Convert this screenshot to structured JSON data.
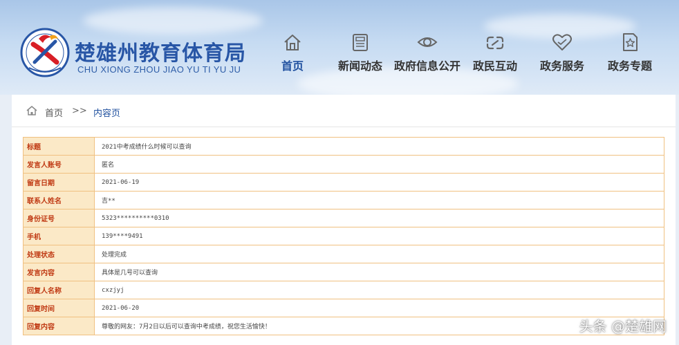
{
  "site": {
    "title": "楚雄州教育体育局",
    "subtitle": "CHU XIONG ZHOU JIAO YU TI YU JU"
  },
  "nav": [
    {
      "label": "首页",
      "icon": "home-icon",
      "active": true
    },
    {
      "label": "新闻动态",
      "icon": "newspaper-icon",
      "active": false
    },
    {
      "label": "政府信息公开",
      "icon": "eye-icon",
      "active": false
    },
    {
      "label": "政民互动",
      "icon": "link-icon",
      "active": false
    },
    {
      "label": "政务服务",
      "icon": "heart-handshake-icon",
      "active": false
    },
    {
      "label": "政务专题",
      "icon": "star-document-icon",
      "active": false
    }
  ],
  "breadcrumb": {
    "home": "首页",
    "separator": ">>",
    "current": "内容页"
  },
  "detail": {
    "rows": [
      {
        "label": "标题",
        "value": "2021中考成绩什么时候可以查询"
      },
      {
        "label": "发言人账号",
        "value": "匿名"
      },
      {
        "label": "留言日期",
        "value": "2021-06-19"
      },
      {
        "label": "联系人姓名",
        "value": "吉**"
      },
      {
        "label": "身份证号",
        "value": "5323**********0310"
      },
      {
        "label": "手机",
        "value": "139****9491"
      },
      {
        "label": "处理状态",
        "value": "处理完成"
      },
      {
        "label": "发言内容",
        "value": "具体是几号可以查询"
      },
      {
        "label": "回复人名称",
        "value": "cxzjyj"
      },
      {
        "label": "回复时间",
        "value": "2021-06-20"
      },
      {
        "label": "回复内容",
        "value": "尊敬的网友：7月2日以后可以查询中考成绩，祝您生活愉快！"
      }
    ]
  },
  "watermark": "头条 @楚雄网",
  "colors": {
    "brand_blue": "#2856a6",
    "label_bg": "#fbe9c7",
    "label_text": "#c03a14",
    "table_border": "#f0c080"
  }
}
